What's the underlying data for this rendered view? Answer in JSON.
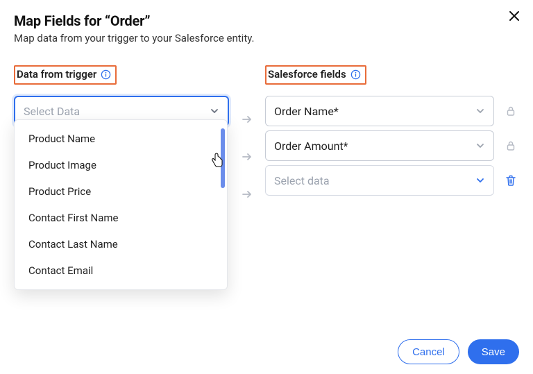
{
  "header": {
    "title": "Map Fields for “Order”",
    "subtitle": "Map data from your trigger to your Salesforce entity."
  },
  "leftSection": {
    "label": "Data from trigger",
    "placeholder": "Select Data",
    "options": [
      "Product Name",
      "Product Image",
      "Product Price",
      "Contact First Name",
      "Contact Last Name",
      "Contact Email"
    ]
  },
  "rightSection": {
    "label": "Salesforce fields",
    "rows": [
      {
        "value": "Order Name*",
        "locked": true
      },
      {
        "value": "Order Amount*",
        "locked": true
      },
      {
        "value": "Select data",
        "placeholder": true,
        "deletable": true
      }
    ]
  },
  "footer": {
    "cancel": "Cancel",
    "save": "Save"
  }
}
